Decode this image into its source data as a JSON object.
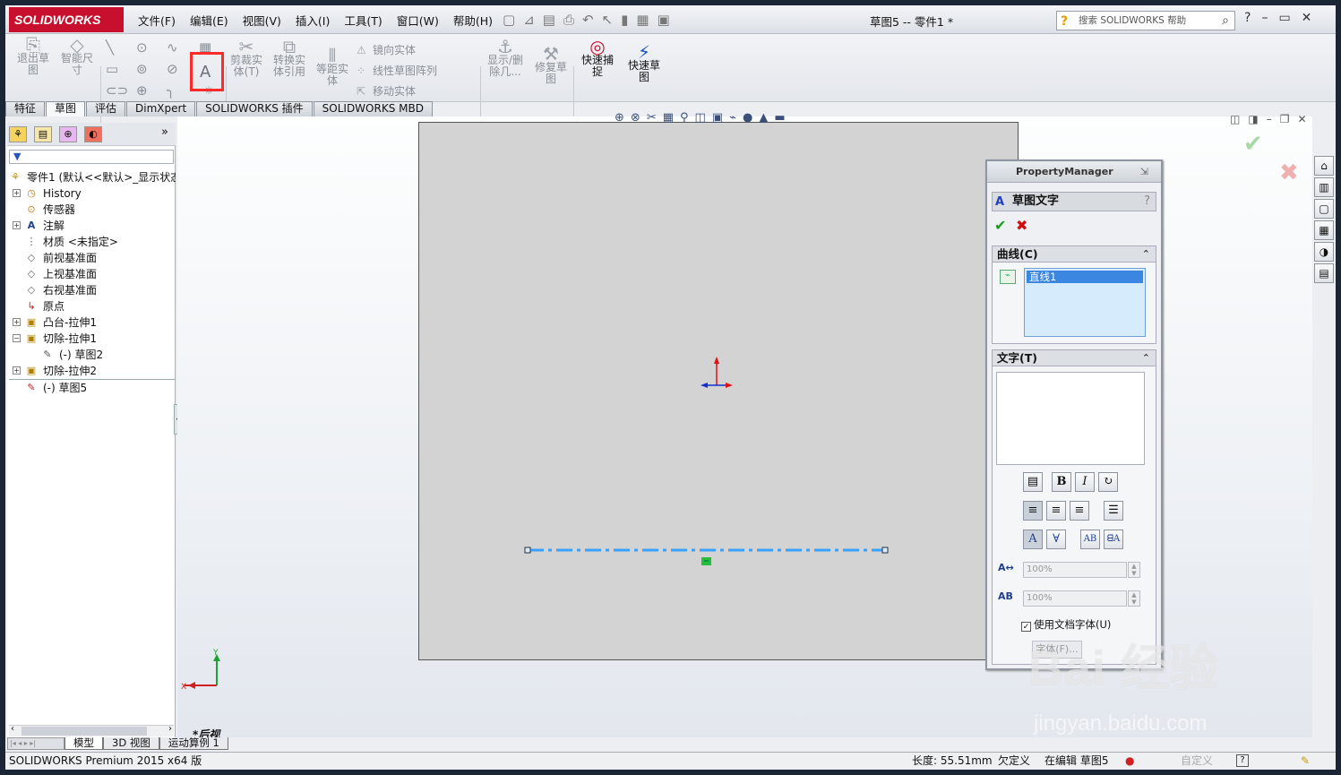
{
  "app": {
    "brand": "SOLIDWORKS",
    "doc_title": "草图5 -- 零件1 *",
    "menu": [
      "文件(F)",
      "编辑(E)",
      "视图(V)",
      "插入(I)",
      "工具(T)",
      "窗口(W)",
      "帮助(H)"
    ],
    "search_placeholder": "搜索 SOLIDWORKS 帮助"
  },
  "ribbon": {
    "exit_sketch": "退出草图",
    "smart_dim": "智能尺寸",
    "trim": "剪裁实体(T)",
    "convert": "转换实体引用",
    "offset": "等距实体",
    "mirror": "镜向实体",
    "linear_pattern": "线性草图阵列",
    "move": "移动实体",
    "show_delete": "显示/删除几...",
    "repair": "修复草图",
    "rapid_snap": "快速捕捉",
    "rapid_sketch": "快速草图"
  },
  "tabs": [
    "特征",
    "草图",
    "评估",
    "DimXpert",
    "SOLIDWORKS 插件",
    "SOLIDWORKS MBD"
  ],
  "active_tab": "草图",
  "tree": {
    "filter_icon": "filter-icon",
    "root": "零件1  (默认<<默认>_显示状态",
    "items": [
      {
        "label": "History",
        "icon": "history-icon"
      },
      {
        "label": "传感器",
        "icon": "sensor-icon"
      },
      {
        "label": "注解",
        "icon": "annotation-icon"
      },
      {
        "label": "材质 <未指定>",
        "icon": "material-icon"
      },
      {
        "label": "前视基准面",
        "icon": "plane-icon"
      },
      {
        "label": "上视基准面",
        "icon": "plane-icon"
      },
      {
        "label": "右视基准面",
        "icon": "plane-icon"
      },
      {
        "label": "原点",
        "icon": "origin-icon"
      },
      {
        "label": "凸台-拉伸1",
        "icon": "boss-extrude-icon"
      },
      {
        "label": "切除-拉伸1",
        "icon": "cut-extrude-icon"
      },
      {
        "label": "(-) 草图2",
        "icon": "sketch-icon"
      },
      {
        "label": "切除-拉伸2",
        "icon": "cut-extrude-icon"
      },
      {
        "label": "(-) 草图5",
        "icon": "sketch-icon"
      }
    ]
  },
  "view": {
    "label": "*后视",
    "axis_x": "X",
    "axis_y": "Y"
  },
  "property_manager": {
    "header": "PropertyManager",
    "title": "草图文字",
    "help": "?",
    "curves_group": "曲线(C)",
    "curves_selected": "直线1",
    "text_group": "文字(T)",
    "text_value": "",
    "width_factor": "100%",
    "spacing": "100%",
    "use_doc_font_label": "使用文档字体(U)",
    "use_doc_font_checked": true,
    "font_button": "字体(F)..."
  },
  "bottom_tabs": [
    "模型",
    "3D 视图",
    "运动算例 1"
  ],
  "status": {
    "product": "SOLIDWORKS Premium 2015 x64 版",
    "length": "长度: 55.51mm",
    "defined": "欠定义",
    "editing": "在编辑 草图5",
    "custom": "自定义",
    "help_icon": "?"
  },
  "watermark": {
    "line1": "Bai 经验",
    "line2": "jingyan.baidu.com"
  },
  "colors": {
    "brand_red": "#c8102e",
    "selection_blue": "#3a86e0",
    "sketch_line": "#3aa0ff",
    "highlight_red": "#ff2a2a"
  }
}
